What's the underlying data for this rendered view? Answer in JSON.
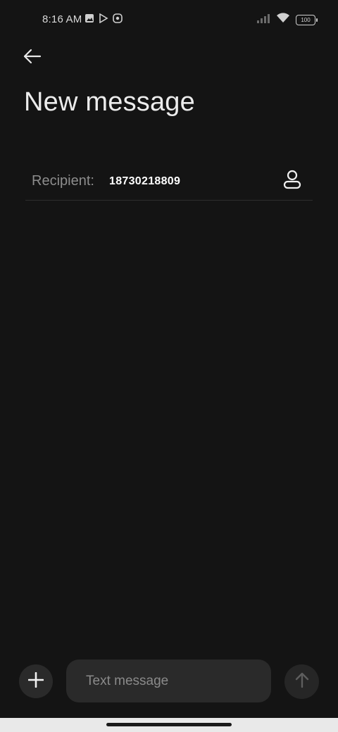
{
  "status_bar": {
    "time": "8:16 AM",
    "left_icons": [
      "gallery-icon",
      "play-store-icon",
      "app-icon"
    ],
    "right_icons": [
      "signal-icon",
      "wifi-icon",
      "battery-icon"
    ],
    "battery_level": "100"
  },
  "header": {
    "back_icon": "arrow-left-icon",
    "title": "New message"
  },
  "recipient": {
    "label": "Recipient:",
    "value": "18730218809",
    "contact_icon": "person-icon"
  },
  "composer": {
    "attach_icon": "plus-icon",
    "placeholder": "Text message",
    "send_icon": "arrow-up-icon"
  },
  "colors": {
    "background": "#141414",
    "surface": "#2a2a2a",
    "text_primary": "#ececec",
    "text_secondary": "#8d8d8d"
  }
}
